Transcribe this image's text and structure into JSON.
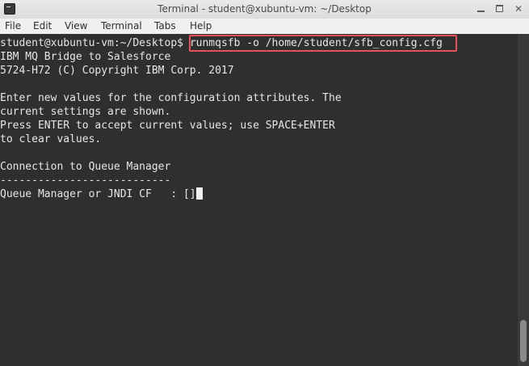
{
  "window": {
    "title": "Terminal - student@xubuntu-vm: ~/Desktop",
    "controls": {
      "minimize": "",
      "maximize": "",
      "close": "✕"
    }
  },
  "menu": [
    "File",
    "Edit",
    "View",
    "Terminal",
    "Tabs",
    "Help"
  ],
  "terminal": {
    "prompt": "student@xubuntu-vm:~/Desktop$ ",
    "command": "runmqsfb -o /home/student/sfb_config.cfg",
    "lines": [
      "IBM MQ Bridge to Salesforce",
      "5724-H72 (C) Copyright IBM Corp. 2017",
      "",
      "Enter new values for the configuration attributes. The",
      "current settings are shown.",
      "Press ENTER to accept current values; use SPACE+ENTER",
      "to clear values.",
      "",
      "Connection to Queue Manager",
      "---------------------------"
    ],
    "input_line": "Queue Manager or JNDI CF   : []"
  },
  "colors": {
    "terminal_bg": "#2f2f2f",
    "terminal_fg": "#e6e6e6",
    "highlight": "#e8505b"
  }
}
